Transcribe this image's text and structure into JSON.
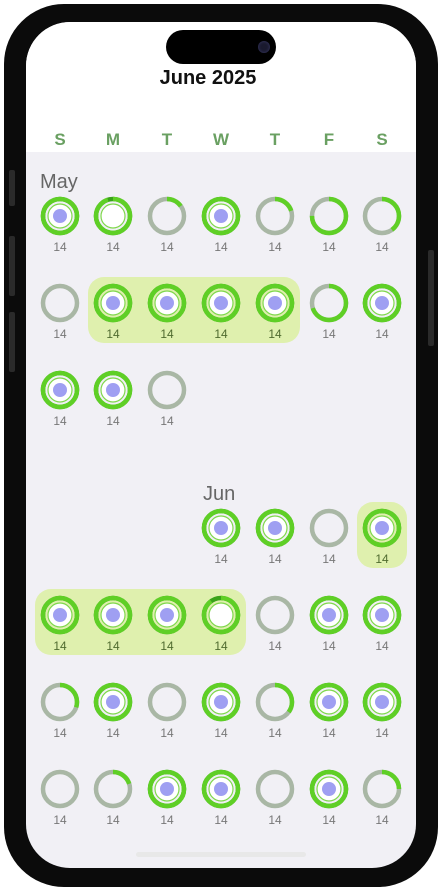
{
  "calendar": {
    "title": "June 2025",
    "weekdays": [
      "S",
      "M",
      "T",
      "W",
      "T",
      "F",
      "S"
    ],
    "months": [
      {
        "label": "May",
        "rows": [
          [
            {
              "v": "14",
              "state": "dot",
              "p": 1
            },
            {
              "v": "14",
              "state": "ring",
              "p": 0.95
            },
            {
              "v": "14",
              "state": "grey",
              "p": 0.15
            },
            {
              "v": "14",
              "state": "dot",
              "p": 1
            },
            {
              "v": "14",
              "state": "grey",
              "p": 0.2
            },
            {
              "v": "14",
              "state": "grey",
              "p": 0.75
            },
            {
              "v": "14",
              "state": "grey",
              "p": 0.4
            }
          ],
          [
            {
              "v": "14",
              "state": "grey",
              "p": 0
            },
            {
              "v": "14",
              "state": "dot",
              "p": 1
            },
            {
              "v": "14",
              "state": "dot",
              "p": 1
            },
            {
              "v": "14",
              "state": "dot",
              "p": 1
            },
            {
              "v": "14",
              "state": "dot",
              "p": 1
            },
            {
              "v": "14",
              "state": "grey",
              "p": 0.7
            },
            {
              "v": "14",
              "state": "dot",
              "p": 1
            }
          ],
          [
            {
              "v": "14",
              "state": "dot",
              "p": 1
            },
            {
              "v": "14",
              "state": "dot",
              "p": 1
            },
            {
              "v": "14",
              "state": "grey",
              "p": 0
            },
            null,
            null,
            null,
            null
          ]
        ],
        "highlights": [
          {
            "row": 1,
            "from": 1,
            "to": 4
          }
        ]
      },
      {
        "label": "Jun",
        "rows": [
          [
            null,
            null,
            null,
            {
              "v": "14",
              "state": "dot",
              "p": 1
            },
            {
              "v": "14",
              "state": "dot",
              "p": 1
            },
            {
              "v": "14",
              "state": "grey",
              "p": 0
            },
            {
              "v": "14",
              "state": "dot",
              "p": 1
            }
          ],
          [
            {
              "v": "14",
              "state": "dot",
              "p": 1
            },
            {
              "v": "14",
              "state": "dot",
              "p": 1
            },
            {
              "v": "14",
              "state": "dot",
              "p": 1
            },
            {
              "v": "14",
              "state": "ring",
              "p": 0.9
            },
            {
              "v": "14",
              "state": "grey",
              "p": 0
            },
            {
              "v": "14",
              "state": "dot",
              "p": 1
            },
            {
              "v": "14",
              "state": "dot",
              "p": 1
            }
          ],
          [
            {
              "v": "14",
              "state": "grey",
              "p": 0.3
            },
            {
              "v": "14",
              "state": "dot",
              "p": 1
            },
            {
              "v": "14",
              "state": "grey",
              "p": 0
            },
            {
              "v": "14",
              "state": "dot",
              "p": 1
            },
            {
              "v": "14",
              "state": "grey",
              "p": 0.35
            },
            {
              "v": "14",
              "state": "dot",
              "p": 1
            },
            {
              "v": "14",
              "state": "dot",
              "p": 1
            }
          ],
          [
            {
              "v": "14",
              "state": "grey",
              "p": 0
            },
            {
              "v": "14",
              "state": "grey",
              "p": 0.2
            },
            {
              "v": "14",
              "state": "dot",
              "p": 1
            },
            {
              "v": "14",
              "state": "dot",
              "p": 1
            },
            {
              "v": "14",
              "state": "grey",
              "p": 0
            },
            {
              "v": "14",
              "state": "dot",
              "p": 1
            },
            {
              "v": "14",
              "state": "grey",
              "p": 0.25
            }
          ]
        ],
        "highlights": [
          {
            "row": 0,
            "from": 6,
            "to": 6
          },
          {
            "row": 1,
            "from": 0,
            "to": 3
          }
        ]
      }
    ]
  },
  "colors": {
    "accent": "#5fcf26",
    "ring_track": "#a9b7a5",
    "dot": "#9f9ff2",
    "highlight": "#dff0ae",
    "weekday": "#6aa062"
  }
}
